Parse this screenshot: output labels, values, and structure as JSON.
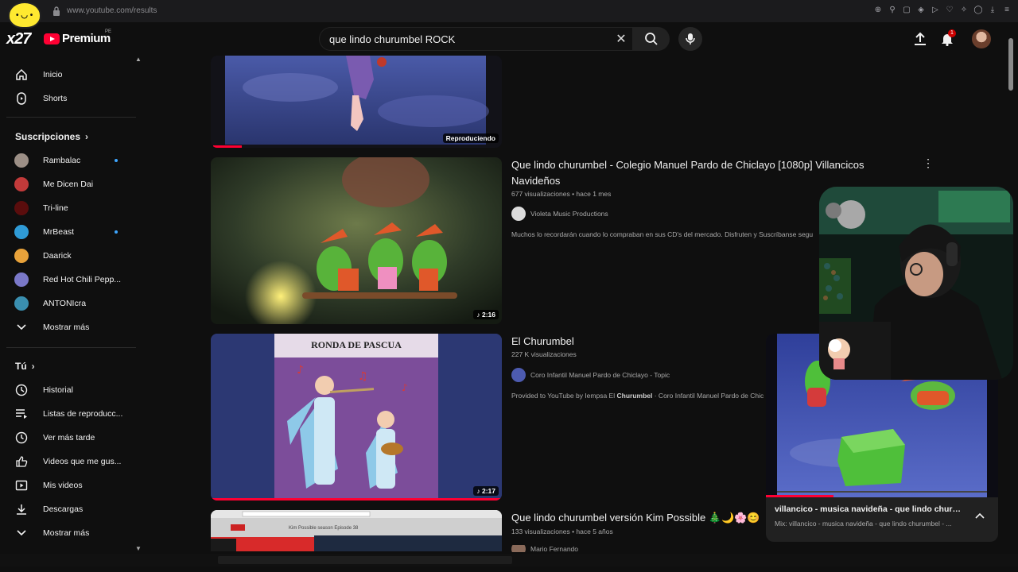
{
  "browser": {
    "url": "www.youtube.com/results"
  },
  "channel_badge": {
    "text": "x27"
  },
  "header": {
    "logo_text": "Premium",
    "country_code": "PE",
    "search_value": "que lindo churumbel ROCK",
    "notification_count": "1"
  },
  "sidebar": {
    "main": [
      {
        "label": "Inicio",
        "icon": "home-icon"
      },
      {
        "label": "Shorts",
        "icon": "shorts-icon"
      }
    ],
    "subscriptions_header": "Suscripciones",
    "subscriptions": [
      {
        "label": "Rambalac",
        "new": true,
        "color": "#9c8f86"
      },
      {
        "label": "Me Dicen Dai",
        "new": false,
        "color": "#c23a3a"
      },
      {
        "label": "Tri-line",
        "new": false,
        "color": "#5a0d0d"
      },
      {
        "label": "MrBeast",
        "new": true,
        "color": "#2f9bd6"
      },
      {
        "label": "Daarick",
        "new": false,
        "color": "#e8a23a"
      },
      {
        "label": "Red Hot Chili Pepp...",
        "new": false,
        "color": "#7a78c8"
      },
      {
        "label": "ANTONIcra",
        "new": false,
        "color": "#3a8fb0"
      }
    ],
    "show_more": "Mostrar más",
    "you_header": "Tú",
    "you_items": [
      {
        "label": "Historial",
        "icon": "history-icon"
      },
      {
        "label": "Listas de reproducc...",
        "icon": "playlists-icon"
      },
      {
        "label": "Ver más tarde",
        "icon": "watch-later-icon"
      },
      {
        "label": "Videos que me gus...",
        "icon": "like-icon"
      },
      {
        "label": "Mis videos",
        "icon": "my-videos-icon"
      },
      {
        "label": "Descargas",
        "icon": "download-icon"
      }
    ],
    "show_more_2": "Mostrar más"
  },
  "results": {
    "playing": {
      "label": "Reproduciendo"
    },
    "items": [
      {
        "title": "Que lindo churumbel - Colegio Manuel Pardo de Chiclayo [1080p] Villancicos Navideños",
        "meta": "677 visualizaciones • hace 1 mes",
        "channel": "Violeta Music Productions",
        "desc": "Muchos lo recordarán cuando lo compraban en sus CD's del mercado. Disfruten y Suscríbanse segu",
        "duration": "2:16"
      },
      {
        "title": "El Churumbel",
        "meta": "227 K visualizaciones",
        "channel": "Coro Infantil Manuel Pardo de Chiclayo - Topic",
        "desc_prefix": "Provided to YouTube by Iempsa El",
        "desc_bold": "Churumbel",
        "desc_suffix": "· Coro Infantil Manuel Pardo de Chic",
        "duration": "2:17",
        "thumb_text": "RONDA DE PASCUA"
      },
      {
        "title": "Que lindo churumbel versión Kim Possible 🎄🌙🌸😊",
        "meta": "133 visualizaciones • hace 5 años",
        "channel": "Mario Fernando",
        "thumb_text": "Kim Possible season Episode 38"
      }
    ]
  },
  "mini_player": {
    "title": "villancico - musica navideña - que lindo churumb...",
    "subtitle": "Mix: villancico - musica navideña - que lindo churumbel - ..."
  }
}
